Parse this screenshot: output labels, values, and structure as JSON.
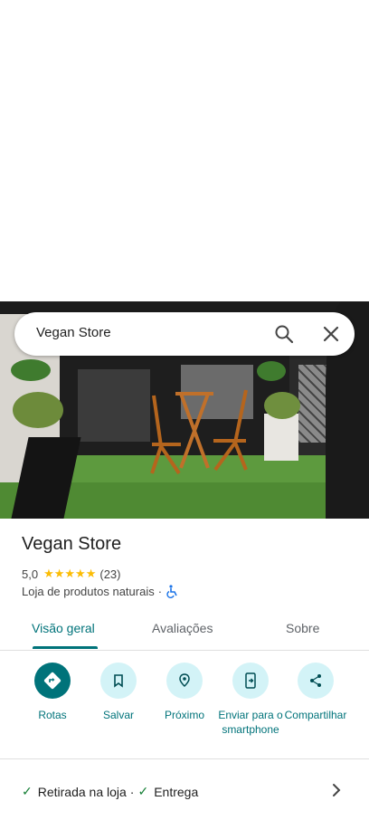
{
  "search": {
    "query": "Vegan Store"
  },
  "place": {
    "name": "Vegan Store",
    "rating": "5,0",
    "stars": "★★★★★",
    "review_count": "(23)",
    "category": "Loja de produtos naturais",
    "separator": "·"
  },
  "tabs": [
    {
      "label": "Visão geral",
      "active": true
    },
    {
      "label": "Avaliações",
      "active": false
    },
    {
      "label": "Sobre",
      "active": false
    }
  ],
  "actions": [
    {
      "label": "Rotas",
      "icon": "directions-icon"
    },
    {
      "label": "Salvar",
      "icon": "bookmark-icon"
    },
    {
      "label": "Próximo",
      "icon": "nearby-icon"
    },
    {
      "label": "Enviar para o smartphone",
      "icon": "send-to-phone-icon"
    },
    {
      "label": "Compartilhar",
      "icon": "share-icon"
    }
  ],
  "services": {
    "item1": "Retirada na loja",
    "sep": "·",
    "item2": "Entrega"
  },
  "colors": {
    "accent": "#00737a",
    "accent_light": "#d3f3f7",
    "star": "#fbbc04",
    "check": "#188038"
  }
}
